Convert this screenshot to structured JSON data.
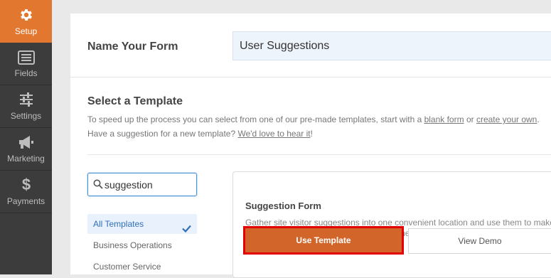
{
  "sidebar": {
    "items": [
      {
        "label": "Setup",
        "icon": "gear-icon",
        "active": true
      },
      {
        "label": "Fields",
        "icon": "fields-icon",
        "active": false
      },
      {
        "label": "Settings",
        "icon": "sliders-icon",
        "active": false
      },
      {
        "label": "Marketing",
        "icon": "megaphone-icon",
        "active": false
      },
      {
        "label": "Payments",
        "icon": "dollar-icon",
        "active": false
      }
    ]
  },
  "form_name": {
    "label": "Name Your Form",
    "value": "User Suggestions"
  },
  "template_section": {
    "title": "Select a Template",
    "desc_part1": "To speed up the process you can select from one of our pre-made templates, start with a ",
    "link_blank": "blank form",
    "desc_part2": " or ",
    "link_create": "create your own",
    "desc_part3": ". Have a suggestion for a new template? ",
    "link_love": "We'd love to hear it",
    "desc_part4": "!"
  },
  "search": {
    "value": "suggestion"
  },
  "categories": [
    {
      "label": "All Templates",
      "active": true
    },
    {
      "label": "Business Operations",
      "active": false
    },
    {
      "label": "Customer Service",
      "active": false
    }
  ],
  "template_card": {
    "title": "Suggestion Form",
    "description": "Gather site visitor suggestions into one convenient location and use them to make data-driven decisions and grow your business.",
    "use_button": "Use Template",
    "demo_button": "View Demo"
  },
  "colors": {
    "accent": "#e27730",
    "sidebar_bg": "#3c3c3c",
    "use_button_bg": "#d2662a",
    "highlight_border": "#e30000",
    "active_category_text": "#2f6fba"
  }
}
